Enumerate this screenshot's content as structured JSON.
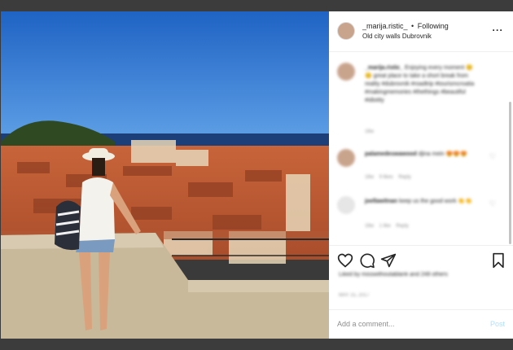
{
  "post": {
    "username": "_marija.ristic_",
    "separator": "•",
    "follow_status": "Following",
    "location": "Old city walls Dubrovnik",
    "more_icon": "more-options-icon"
  },
  "comments": [
    {
      "username": "_marija.ristic_",
      "text": "Enjoying every moment 😊😊 great place to take a short break from reality #dubrovnik #roadtrip #tourismcroatia #makingmemories #thethings #beautiful #idiotity",
      "meta": [
        "16w"
      ]
    },
    {
      "username": "palamedeswawood",
      "text": "djina mein 😍😍😍",
      "meta": [
        "16w",
        "9 likes",
        "Reply"
      ]
    },
    {
      "username": "joellawitnan",
      "text": "keep us the good work 👏👏",
      "meta": [
        "16w",
        "1 like",
        "Reply"
      ]
    }
  ],
  "likes_text": "Liked by misswithoutablank and 248 others",
  "date_text": "MAY 15, 2017",
  "add_comment": {
    "placeholder": "Add a comment...",
    "post_label": "Post"
  },
  "colors": {
    "link": "#00376b",
    "muted": "#8e8e8e",
    "post_disabled": "#b2dffc",
    "panel_bg": "#ffffff",
    "chrome": "#3c3c3c"
  }
}
